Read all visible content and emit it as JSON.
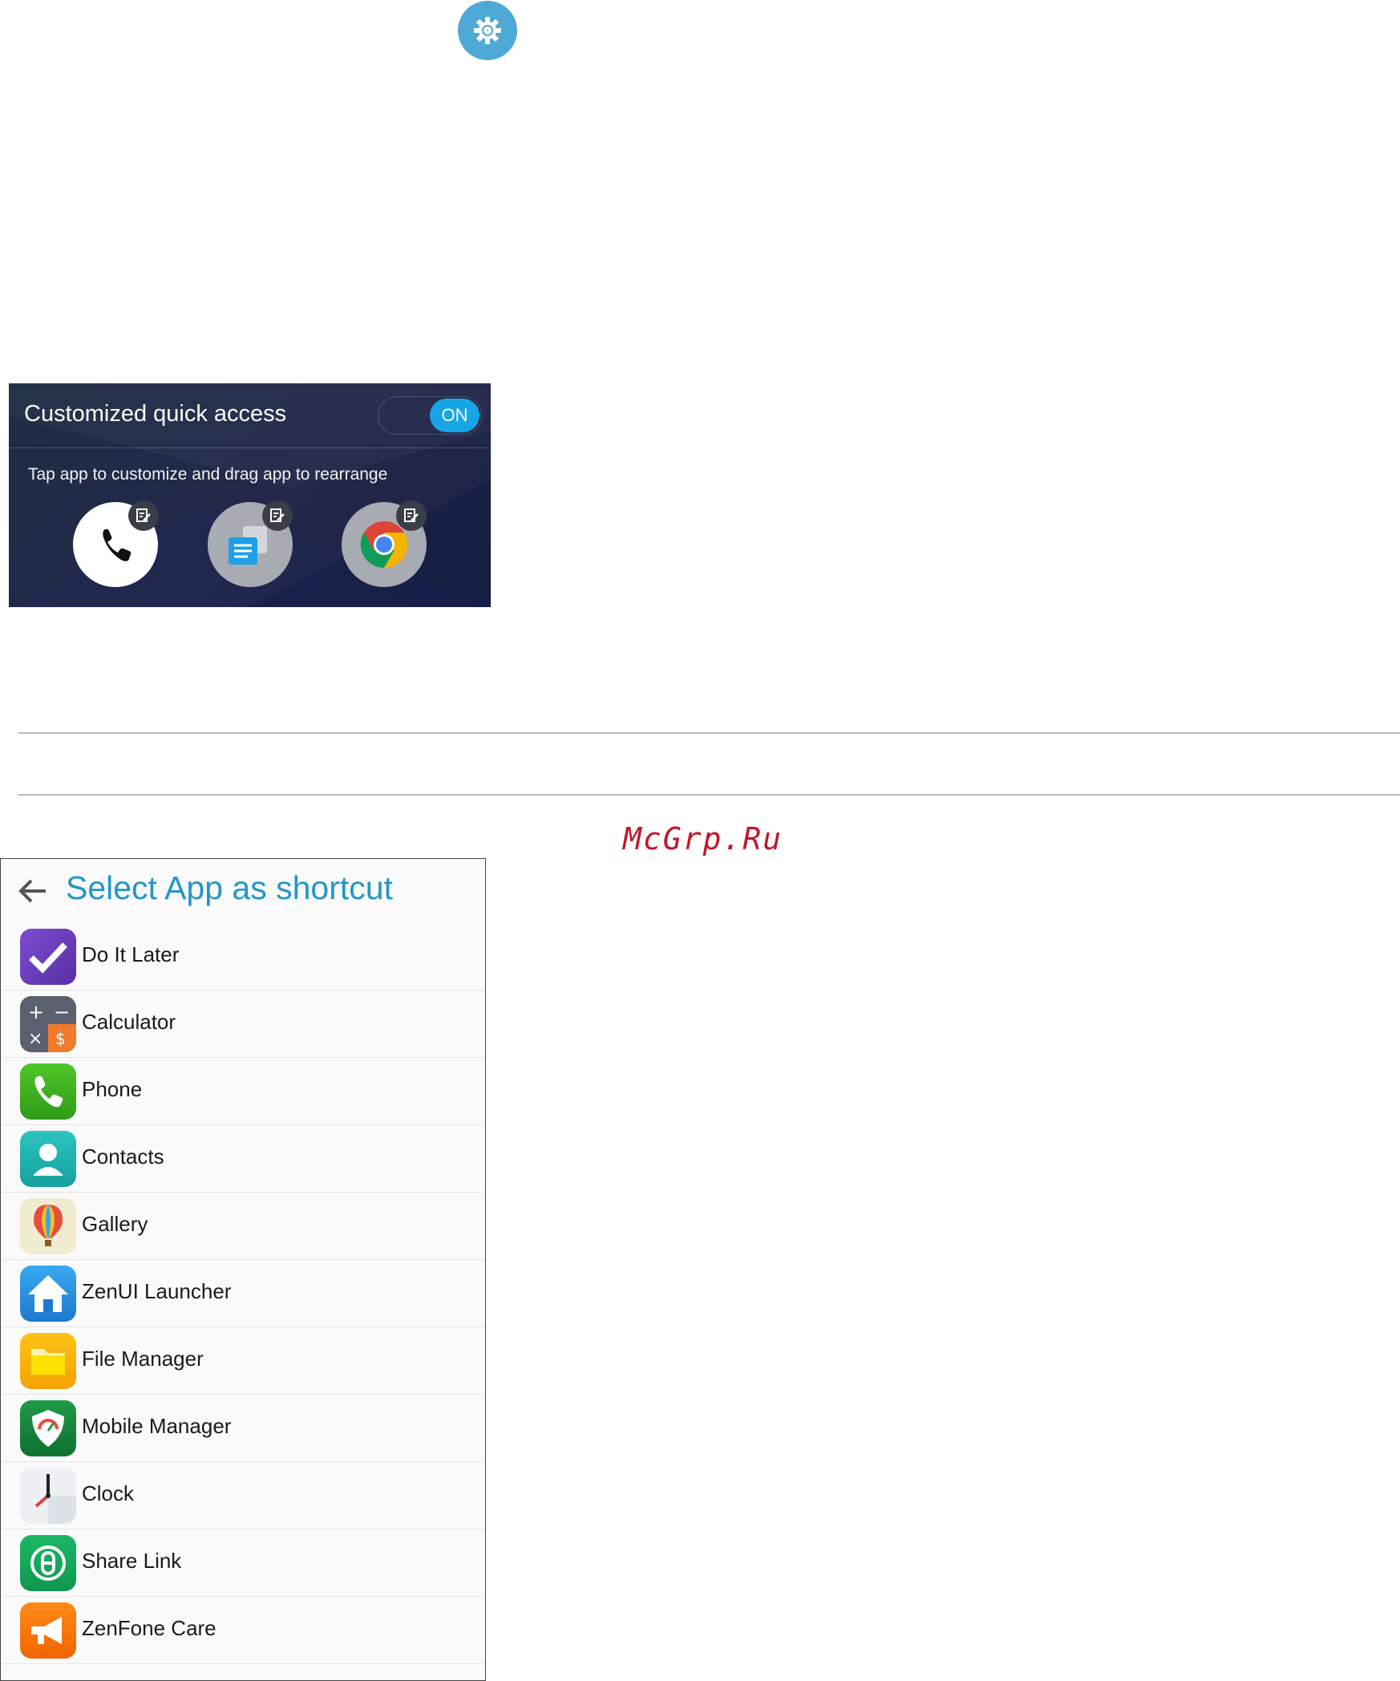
{
  "quick_access": {
    "title": "Customized quick access",
    "toggle_label": "ON",
    "subtitle": "Tap app to customize and drag app to rearrange",
    "apps": [
      "phone-icon",
      "messages-icon",
      "chrome-icon"
    ]
  },
  "watermark": "McGrp.Ru",
  "app_picker": {
    "title": "Select App as shortcut",
    "apps": [
      {
        "label": "Do It Later",
        "icon": "do-it-later-icon"
      },
      {
        "label": "Calculator",
        "icon": "calculator-icon"
      },
      {
        "label": "Phone",
        "icon": "phone-icon"
      },
      {
        "label": "Contacts",
        "icon": "contacts-icon"
      },
      {
        "label": "Gallery",
        "icon": "gallery-icon"
      },
      {
        "label": "ZenUI Launcher",
        "icon": "zenui-launcher-icon"
      },
      {
        "label": "File Manager",
        "icon": "file-manager-icon"
      },
      {
        "label": "Mobile Manager",
        "icon": "mobile-manager-icon"
      },
      {
        "label": "Clock",
        "icon": "clock-icon"
      },
      {
        "label": "Share Link",
        "icon": "share-link-icon"
      },
      {
        "label": "ZenFone Care",
        "icon": "zenfone-care-icon"
      }
    ]
  },
  "colors": {
    "accent": "#2496c7",
    "toggle_on": "#16a6e6",
    "panel_bg": "#1d2e44",
    "watermark": "#c0172b"
  }
}
